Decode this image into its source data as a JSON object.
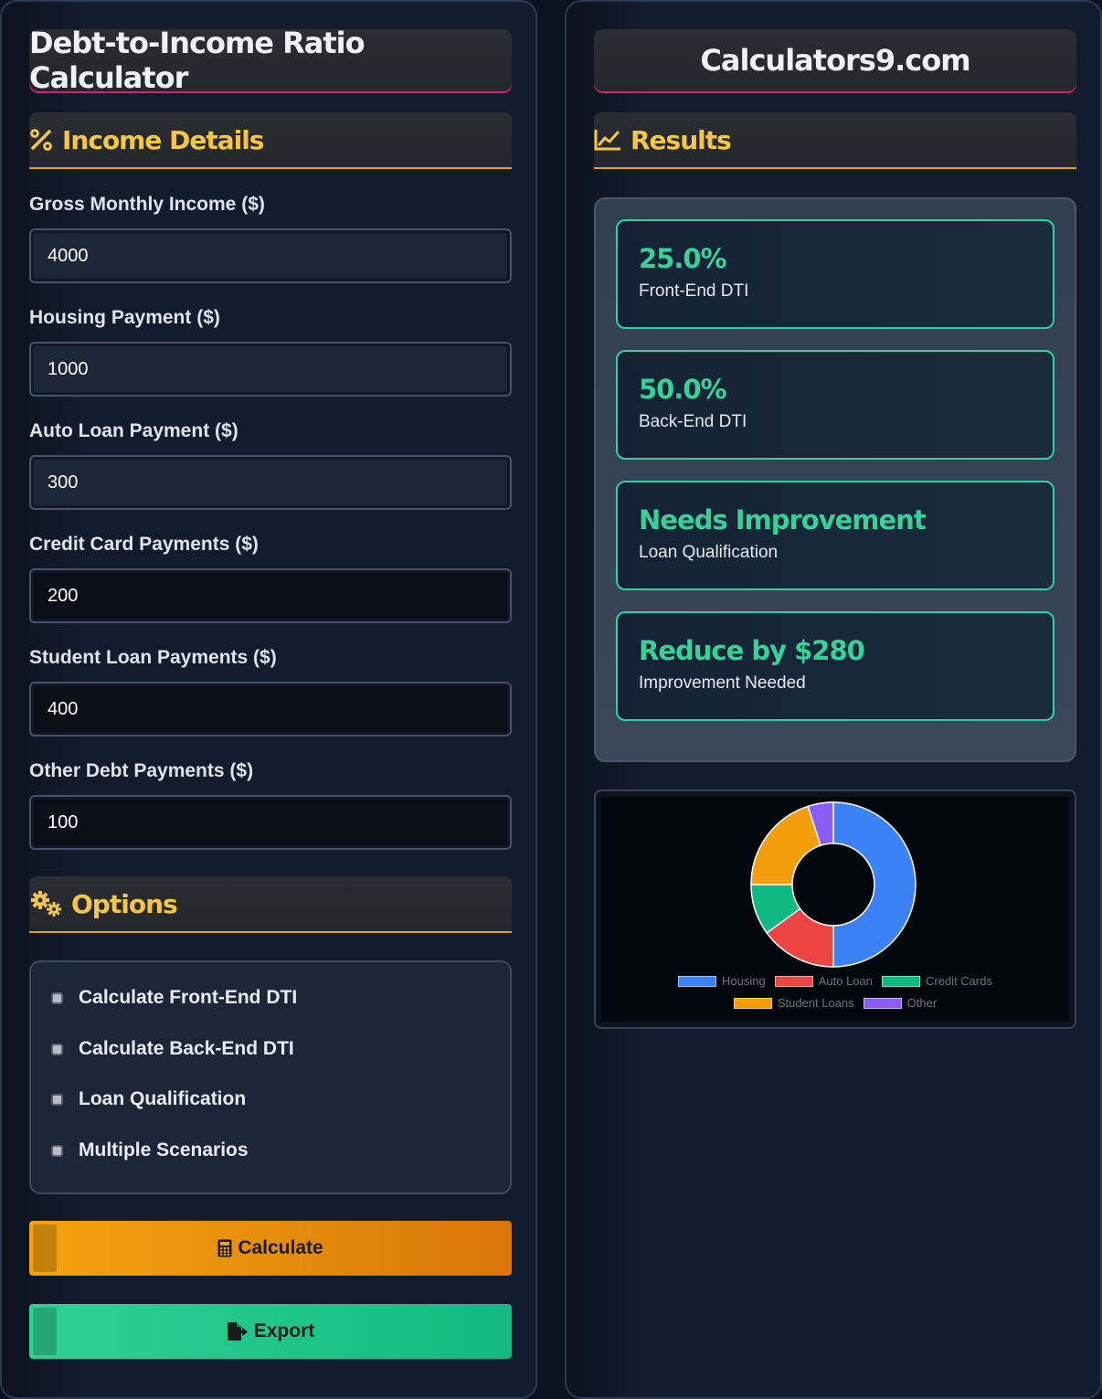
{
  "left": {
    "title": "Debt-to-Income Ratio Calculator",
    "income_section": {
      "title": "Income Details",
      "icon": "percent-icon"
    },
    "fields": [
      {
        "label": "Gross Monthly Income ($)",
        "value": "4000"
      },
      {
        "label": "Housing Payment ($)",
        "value": "1000"
      },
      {
        "label": "Auto Loan Payment ($)",
        "value": "300"
      },
      {
        "label": "Credit Card Payments ($)",
        "value": "200"
      },
      {
        "label": "Student Loan Payments ($)",
        "value": "400"
      },
      {
        "label": "Other Debt Payments ($)",
        "value": "100"
      }
    ],
    "options_section": {
      "title": "Options",
      "icon": "gears-icon"
    },
    "options": [
      {
        "label": "Calculate Front-End DTI"
      },
      {
        "label": "Calculate Back-End DTI"
      },
      {
        "label": "Loan Qualification"
      },
      {
        "label": "Multiple Scenarios"
      }
    ],
    "buttons": {
      "calculate": "Calculate",
      "export": "Export"
    }
  },
  "right": {
    "title": "Calculators9.com",
    "results_section": {
      "title": "Results",
      "icon": "chart-line-icon"
    },
    "results": [
      {
        "value": "25.0%",
        "label": "Front-End DTI"
      },
      {
        "value": "50.0%",
        "label": "Back-End DTI"
      },
      {
        "value": "Needs Improvement",
        "label": "Loan Qualification"
      },
      {
        "value": "Reduce by $280",
        "label": "Improvement Needed"
      }
    ]
  },
  "colors": {
    "accent_gold": "#f7c744",
    "result_green": "#34d399",
    "title_underline": "#e11d74"
  },
  "chart_data": {
    "type": "pie",
    "donut": true,
    "categories": [
      "Housing",
      "Auto Loan",
      "Credit Cards",
      "Student Loans",
      "Other"
    ],
    "values": [
      1000,
      300,
      200,
      400,
      100
    ],
    "colors": [
      "#3b82f6",
      "#ef4444",
      "#10b981",
      "#f59e0b",
      "#8b5cf6"
    ],
    "legend": "bottom"
  }
}
